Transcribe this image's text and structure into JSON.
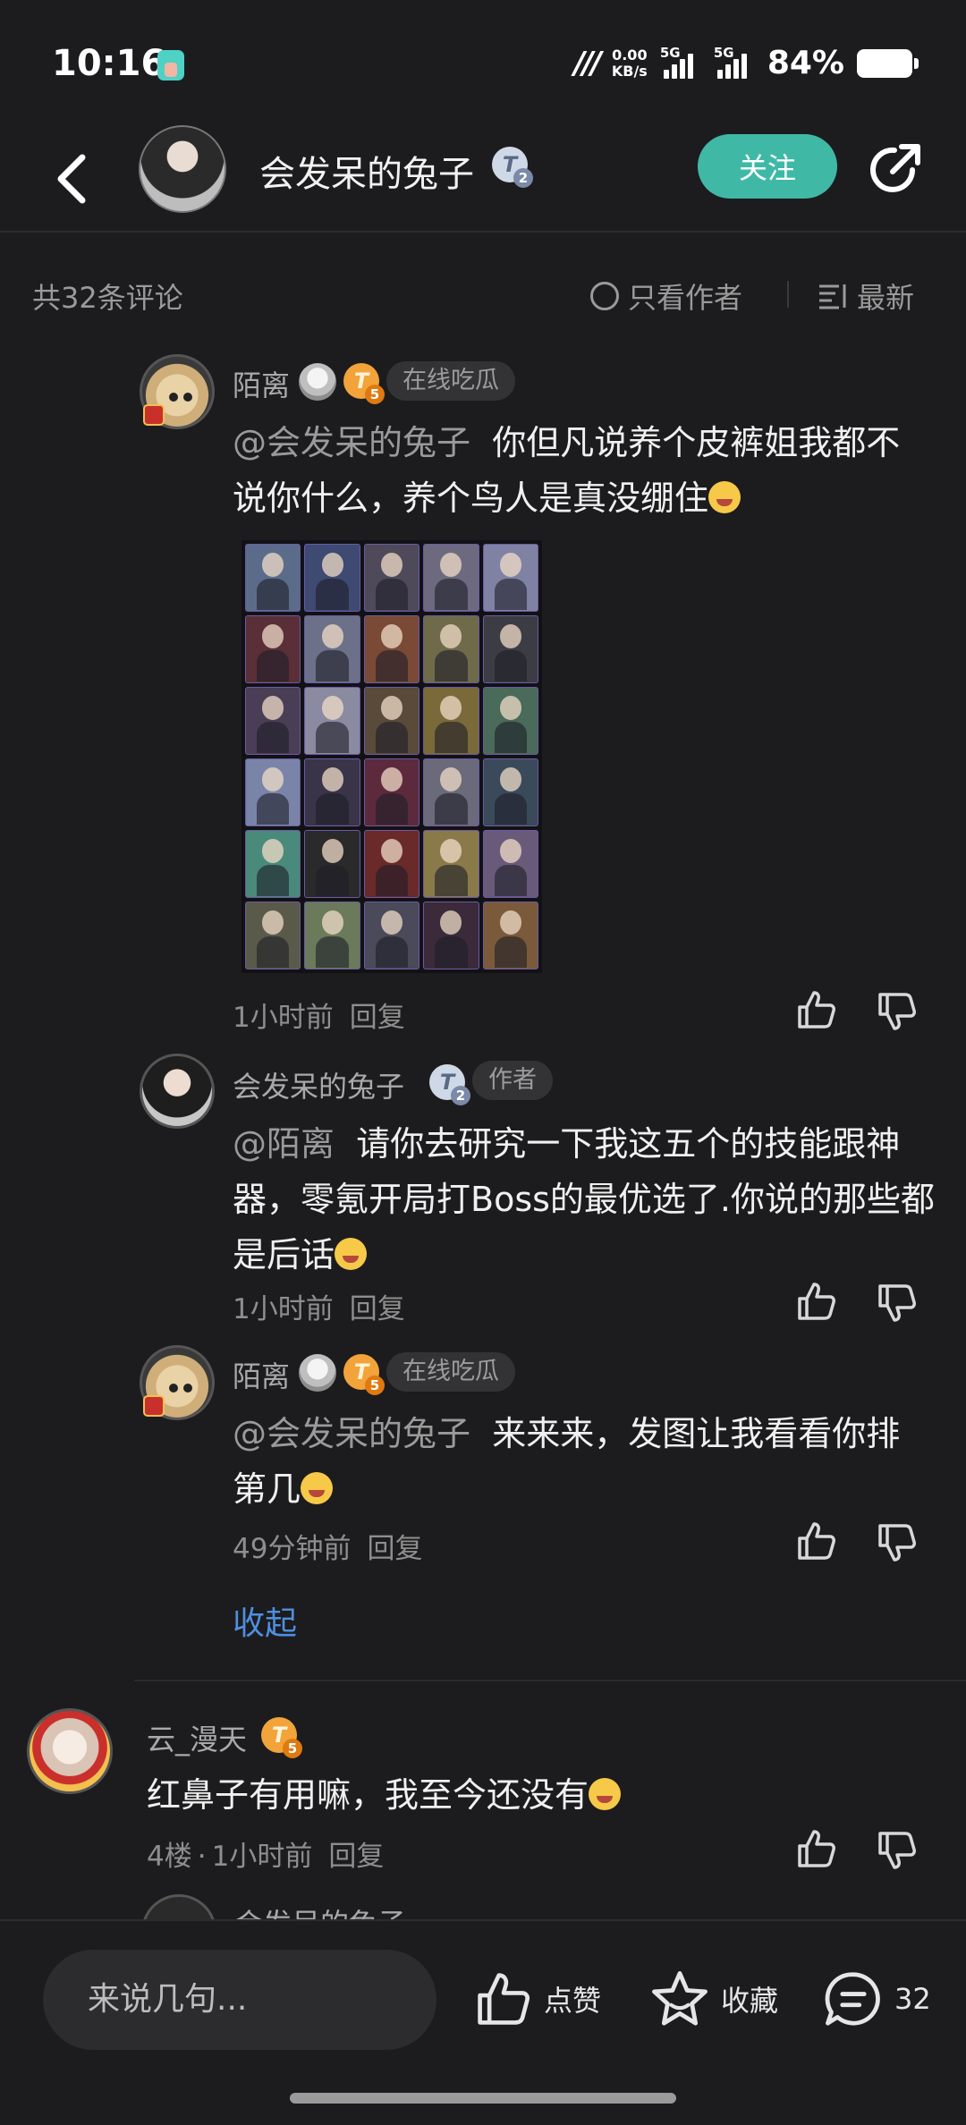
{
  "status_bar": {
    "time": "10:16",
    "net_speed_value": "0.00",
    "net_speed_unit": "KB/s",
    "sim1": "5G",
    "sim2": "5G",
    "battery": "84%"
  },
  "header": {
    "author_name": "会发呆的兔子",
    "author_level": "2",
    "follow_label": "关注"
  },
  "comments_bar": {
    "count_label": "共32条评论",
    "author_only_label": "只看作者",
    "sort_label": "最新"
  },
  "replies": [
    {
      "name": "陌离",
      "level": "5",
      "tag": "在线吃瓜",
      "mention": "@会发呆的兔子",
      "text": "你但凡说养个皮裤姐我都不说你什么，养个鸟人是真没绷住",
      "time": "1小时前",
      "reply_label": "回复"
    },
    {
      "name": "会发呆的兔子",
      "level": "2",
      "tag": "作者",
      "mention": "@陌离",
      "text": "请你去研究一下我这五个的技能跟神器，零氪开局打Boss的最优选了.你说的那些都是后话",
      "time": "1小时前",
      "reply_label": "回复"
    },
    {
      "name": "陌离",
      "level": "5",
      "tag": "在线吃瓜",
      "mention": "@会发呆的兔子",
      "text": "来来来，发图让我看看你排第几",
      "time": "49分钟前",
      "reply_label": "回复"
    }
  ],
  "collapse_label": "收起",
  "floor_comment": {
    "name": "云_漫天",
    "level": "5",
    "text": "红鼻子有用嘛，我至今还没有",
    "floor": "4楼",
    "time": "1小时前",
    "reply_label": "回复"
  },
  "peek_comment": {
    "name": "会发呆的兔子"
  },
  "bottom_bar": {
    "input_placeholder": "来说几句...",
    "like_label": "点赞",
    "favorite_label": "收藏",
    "comment_count": "32"
  },
  "icons": {
    "back": "chevron-left-icon",
    "share": "share-icon",
    "like": "thumbs-up-icon",
    "dislike": "thumbs-down-icon",
    "favorite": "star-icon",
    "comment": "chat-bubble-icon",
    "sort": "sort-lines-icon"
  },
  "colors": {
    "background": "#1c1c1e",
    "accent": "#3fb9a6",
    "link": "#4f8fe0",
    "muted_text": "#9a9a9a"
  }
}
